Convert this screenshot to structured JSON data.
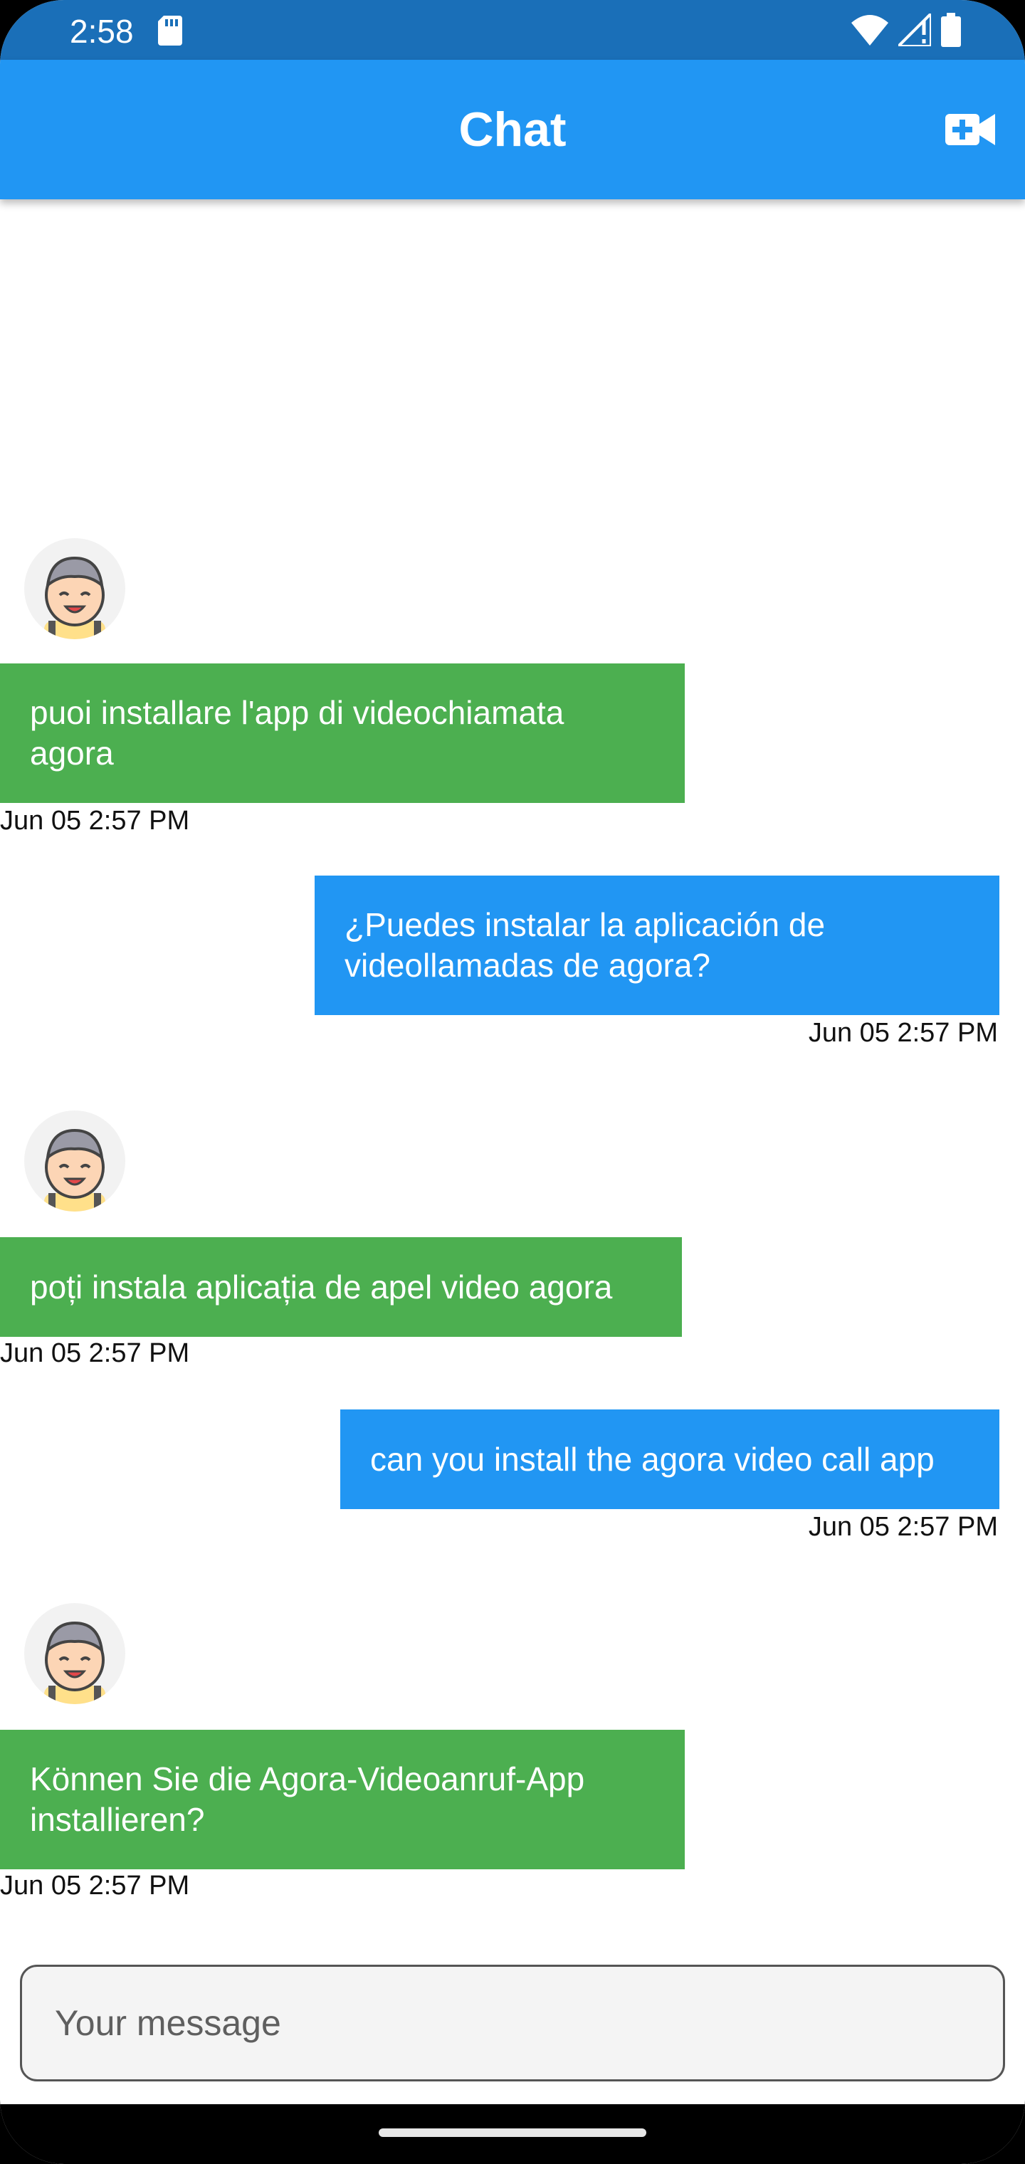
{
  "status_bar": {
    "time": "2:58",
    "icons": [
      "sd-card-icon",
      "wifi-icon",
      "signal-icon",
      "battery-icon"
    ]
  },
  "app_bar": {
    "title": "Chat",
    "action_icon": "video-call-icon"
  },
  "messages": [
    {
      "direction": "received",
      "text": "puoi installare l'app di videochiamata agora",
      "time": "Jun 05 2:57 PM"
    },
    {
      "direction": "sent",
      "text": "¿Puedes instalar la aplicación de videollamadas de agora?",
      "time": "Jun 05 2:57 PM"
    },
    {
      "direction": "received",
      "text": "poți instala aplicația de apel video agora",
      "time": "Jun 05 2:57 PM"
    },
    {
      "direction": "sent",
      "text": "can you install the agora video call app",
      "time": "Jun 05 2:57 PM"
    },
    {
      "direction": "received",
      "text": "Können Sie die Agora-Videoanruf-App installieren?",
      "time": "Jun 05 2:57 PM"
    }
  ],
  "composer": {
    "placeholder": "Your message",
    "value": ""
  },
  "colors": {
    "status_bar": "#1a6fb8",
    "app_bar": "#2196f3",
    "sent_bubble": "#2196f3",
    "received_bubble": "#4caf50"
  }
}
